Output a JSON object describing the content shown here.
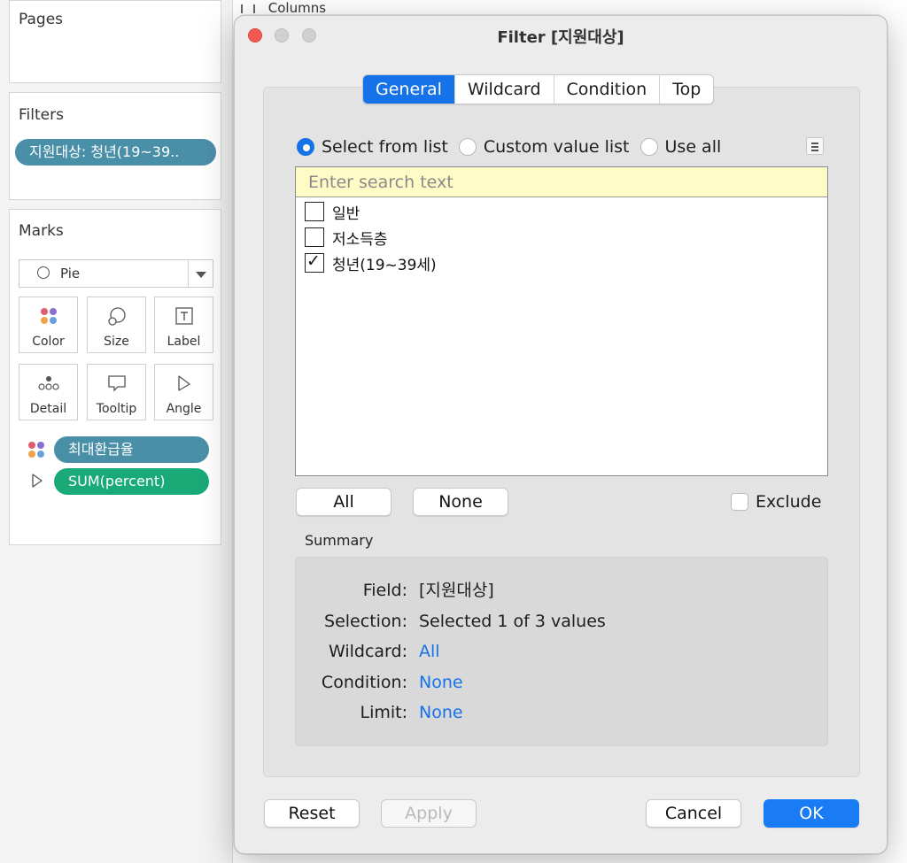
{
  "side": {
    "pages_title": "Pages",
    "filters_title": "Filters",
    "filter_pill": "지원대상: 청년(19~39..",
    "marks_title": "Marks",
    "mark_type": "Pie",
    "mark_buttons": [
      "Color",
      "Size",
      "Label",
      "Detail",
      "Tooltip",
      "Angle"
    ],
    "mark_pills": [
      {
        "label": "최대환급율",
        "color": "#4a8fa8",
        "icon": "color-dots-icon"
      },
      {
        "label": "SUM(percent)",
        "color": "#1aaa77",
        "icon": "angle-icon"
      }
    ]
  },
  "shelf": {
    "columns_label": "Columns"
  },
  "dialog": {
    "title": "Filter [지원대상]",
    "tabs": [
      "General",
      "Wildcard",
      "Condition",
      "Top"
    ],
    "active_tab": "General",
    "radio_options": [
      "Select from list",
      "Custom value list",
      "Use all"
    ],
    "selected_radio": "Select from list",
    "search_placeholder": "Enter search text",
    "items": [
      {
        "label": "일반",
        "checked": false
      },
      {
        "label": "저소득층",
        "checked": false
      },
      {
        "label": "청년(19~39세)",
        "checked": true
      }
    ],
    "all_button": "All",
    "none_button": "None",
    "exclude_label": "Exclude",
    "summary_title": "Summary",
    "summary": [
      {
        "key": "Field:",
        "value": "[지원대상]",
        "link": false
      },
      {
        "key": "Selection:",
        "value": "Selected 1 of 3 values",
        "link": false
      },
      {
        "key": "Wildcard:",
        "value": "All",
        "link": true
      },
      {
        "key": "Condition:",
        "value": "None",
        "link": true
      },
      {
        "key": "Limit:",
        "value": "None",
        "link": true
      }
    ],
    "buttons": {
      "reset": "Reset",
      "apply": "Apply",
      "cancel": "Cancel",
      "ok": "OK"
    },
    "colors": {
      "accent": "#1672e8",
      "close": "#ee5a52",
      "inactive_light": "#d0d0d0"
    }
  }
}
